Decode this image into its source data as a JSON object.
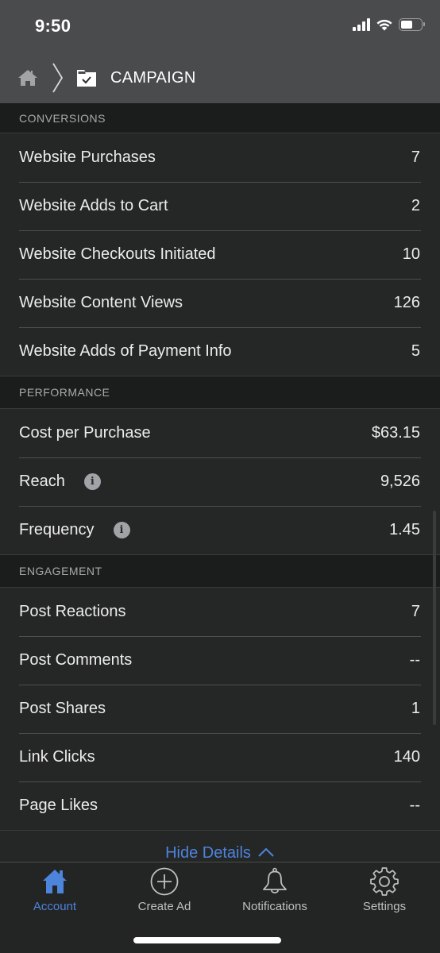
{
  "status_bar": {
    "time": "9:50",
    "icons": [
      "cellular-signal-icon",
      "wifi-icon",
      "battery-icon"
    ]
  },
  "header": {
    "breadcrumb": {
      "home_icon": "home-icon",
      "separator_icon": "chevron-right-icon",
      "level_icon": "campaign-folder-check-icon",
      "title": "CAMPAIGN"
    }
  },
  "sections": [
    {
      "title": "CONVERSIONS",
      "rows": [
        {
          "label": "Website Purchases",
          "value": "7"
        },
        {
          "label": "Website Adds to Cart",
          "value": "2"
        },
        {
          "label": "Website Checkouts Initiated",
          "value": "10"
        },
        {
          "label": "Website Content Views",
          "value": "126"
        },
        {
          "label": "Website Adds of Payment Info",
          "value": "5"
        }
      ]
    },
    {
      "title": "PERFORMANCE",
      "rows": [
        {
          "label": "Cost per Purchase",
          "value": "$63.15"
        },
        {
          "label": "Reach",
          "value": "9,526",
          "info": "i"
        },
        {
          "label": "Frequency",
          "value": "1.45",
          "info": "i"
        }
      ]
    },
    {
      "title": "ENGAGEMENT",
      "rows": [
        {
          "label": "Post Reactions",
          "value": "7"
        },
        {
          "label": "Post Comments",
          "value": "--"
        },
        {
          "label": "Post Shares",
          "value": "1"
        },
        {
          "label": "Link Clicks",
          "value": "140"
        },
        {
          "label": "Page Likes",
          "value": "--"
        }
      ]
    }
  ],
  "toggle": {
    "label": "Hide Details",
    "icon": "chevron-up-icon"
  },
  "tab_bar": {
    "active": "Account",
    "tabs": [
      {
        "label": "Account",
        "icon": "home-icon"
      },
      {
        "label": "Create Ad",
        "icon": "plus-circle-icon"
      },
      {
        "label": "Notifications",
        "icon": "bell-icon"
      },
      {
        "label": "Settings",
        "icon": "gear-icon"
      }
    ]
  },
  "colors": {
    "accent": "#4d84dc",
    "header_bg": "#4a4b4d",
    "section_bg": "#1b1c1c",
    "row_bg": "#252626",
    "text": "#ececec",
    "muted_text": "#a9aaab"
  }
}
